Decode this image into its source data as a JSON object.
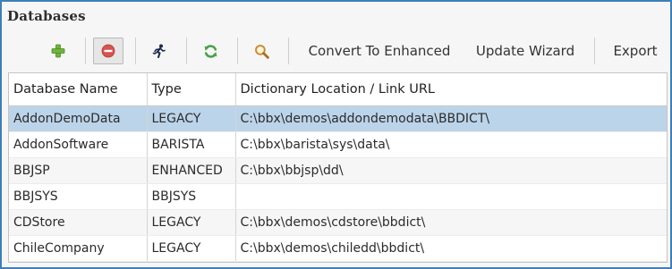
{
  "panel": {
    "title": "Databases"
  },
  "toolbar": {
    "add_icon": "plus-icon",
    "remove_icon": "minus-circle-icon",
    "run_icon": "running-man-icon",
    "refresh_icon": "refresh-arrows-icon",
    "search_icon": "magnifier-icon",
    "convert_label": "Convert To Enhanced",
    "update_wizard_label": "Update Wizard",
    "export_label": "Export"
  },
  "table": {
    "headers": [
      "Database Name",
      "Type",
      "Dictionary Location / Link URL"
    ],
    "rows": [
      {
        "name": "AddonDemoData",
        "type": "LEGACY",
        "location": "C:\\bbx\\demos\\addondemodata\\BBDICT\\"
      },
      {
        "name": "AddonSoftware",
        "type": "BARISTA",
        "location": "C:\\bbx\\barista\\sys\\data\\"
      },
      {
        "name": "BBJSP",
        "type": "ENHANCED",
        "location": "C:\\bbx\\bbjsp\\dd\\"
      },
      {
        "name": "BBJSYS",
        "type": "BBJSYS",
        "location": ""
      },
      {
        "name": "CDStore",
        "type": "LEGACY",
        "location": "C:\\bbx\\demos\\cdstore\\bbdict\\"
      },
      {
        "name": "ChileCompany",
        "type": "LEGACY",
        "location": "C:\\bbx\\demos\\chiledd\\bbdict\\"
      }
    ],
    "selected_row": 0
  },
  "colors": {
    "frame": "#3d7fb9",
    "selected_row": "#bcd4ea",
    "add_green": "#6fb43c",
    "remove_red": "#d9534f"
  }
}
